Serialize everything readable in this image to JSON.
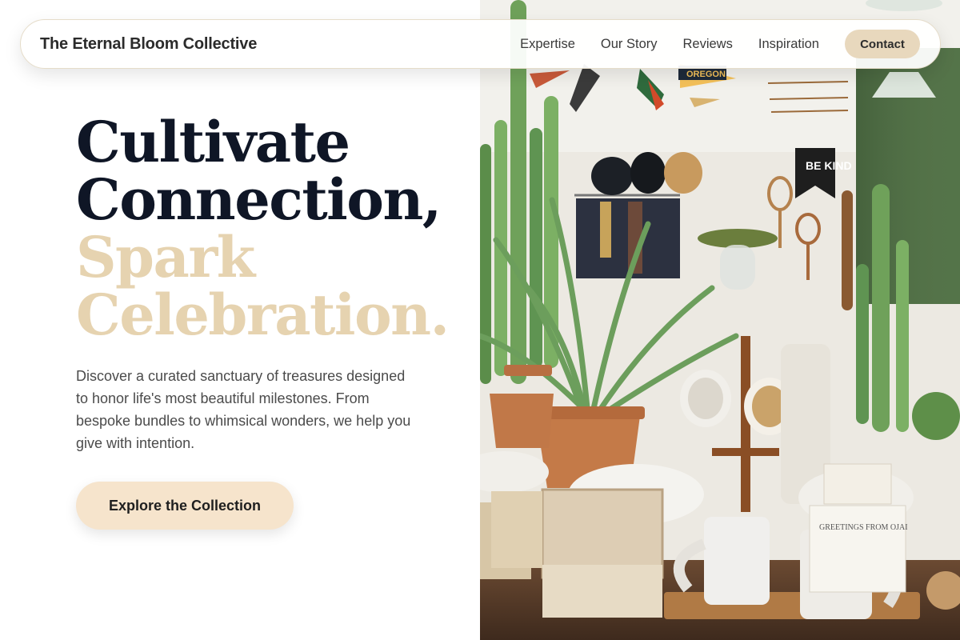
{
  "brand": {
    "name": "The Eternal Bloom Collective"
  },
  "nav": {
    "links": [
      "Expertise",
      "Our Story",
      "Reviews",
      "Inspiration"
    ],
    "contact_label": "Contact"
  },
  "hero": {
    "headline_line1": "Cultivate",
    "headline_line2": "Connection,",
    "headline_line3": "Spark",
    "headline_line4": "Celebration.",
    "description": "Discover a curated sanctuary of treasures designed to honor life's most beautiful milestones. From bespoke bundles to whimsical wonders, we help you give with intention.",
    "cta_label": "Explore the Collection"
  },
  "photo": {
    "banner_text": "BE KIND",
    "pennant_text": "OREGON",
    "card_text": "GREETINGS FROM OJAI"
  },
  "colors": {
    "headline_dark": "#0f1626",
    "headline_accent": "#e6d3b0",
    "contact_bg": "#e8d8bd",
    "cta_bg": "#f6e4cc"
  }
}
